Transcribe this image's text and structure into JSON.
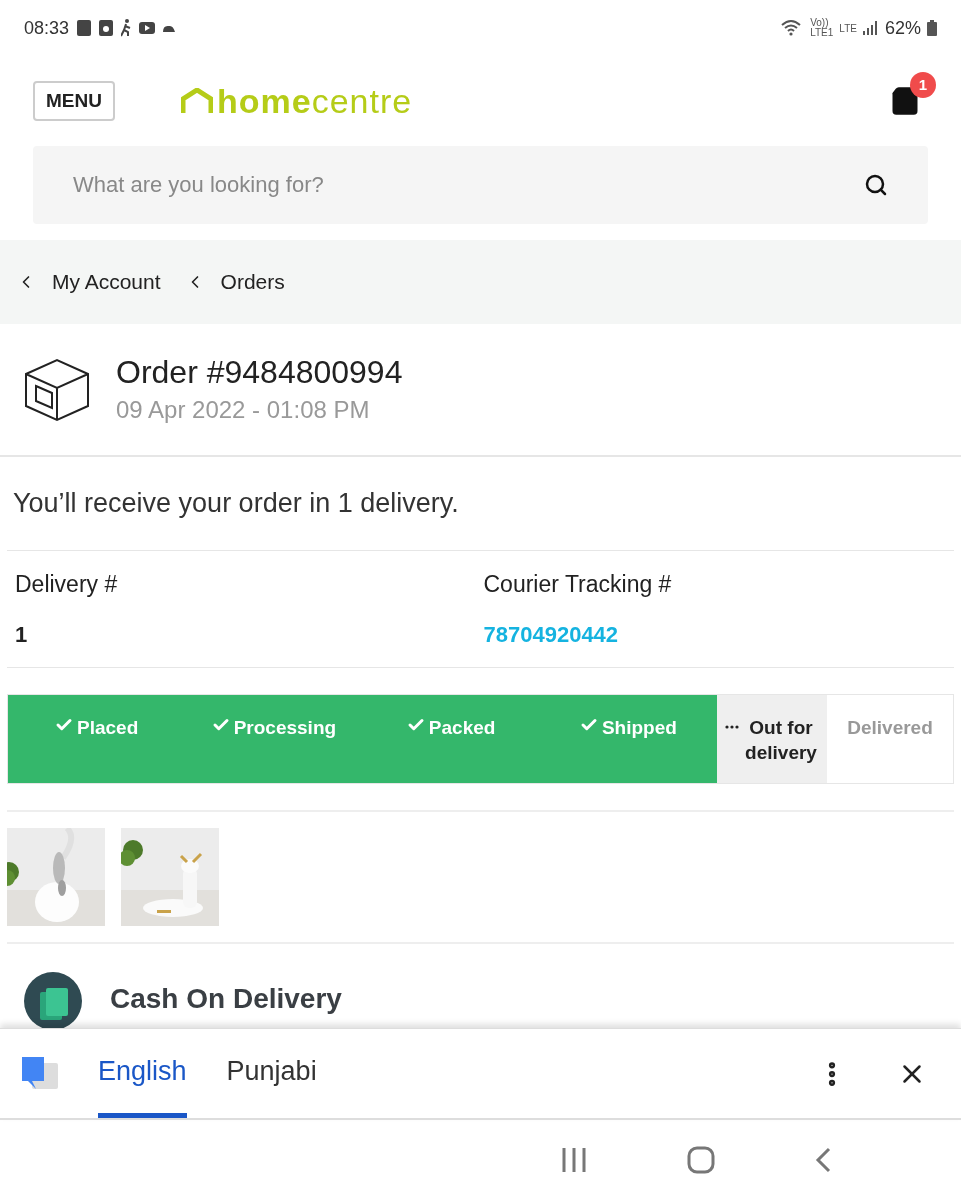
{
  "status_bar": {
    "time": "08:33",
    "volte": "Vo))",
    "lte1": "LTE1",
    "lte": "LTE",
    "battery": "62%"
  },
  "header": {
    "menu_label": "MENU",
    "logo": "**home**centre",
    "cart_count": "1"
  },
  "search": {
    "placeholder": "What are you looking for?"
  },
  "breadcrumb": [
    {
      "label": "My Account"
    },
    {
      "label": "Orders"
    }
  ],
  "order": {
    "title": "Order #9484800994",
    "date": "09 Apr 2022 - 01:08 PM"
  },
  "delivery_summary": "You’ll receive your order in 1 delivery.",
  "delivery": {
    "number_label": "Delivery #",
    "number": "1",
    "tracking_label": "Courier Tracking #",
    "tracking": "78704920442"
  },
  "steps": [
    {
      "label": "Placed",
      "kind": "done"
    },
    {
      "label": "Processing",
      "kind": "done"
    },
    {
      "label": "Packed",
      "kind": "done"
    },
    {
      "label": "Shipped",
      "kind": "done"
    },
    {
      "label": "Out for delivery",
      "kind": "current"
    },
    {
      "label": "Delivered",
      "kind": "pending"
    }
  ],
  "payment": {
    "method": "Cash On Delivery"
  },
  "translate_bar": {
    "tabs": [
      {
        "label": "English",
        "selected": true
      },
      {
        "label": "Punjabi",
        "selected": false
      }
    ]
  }
}
